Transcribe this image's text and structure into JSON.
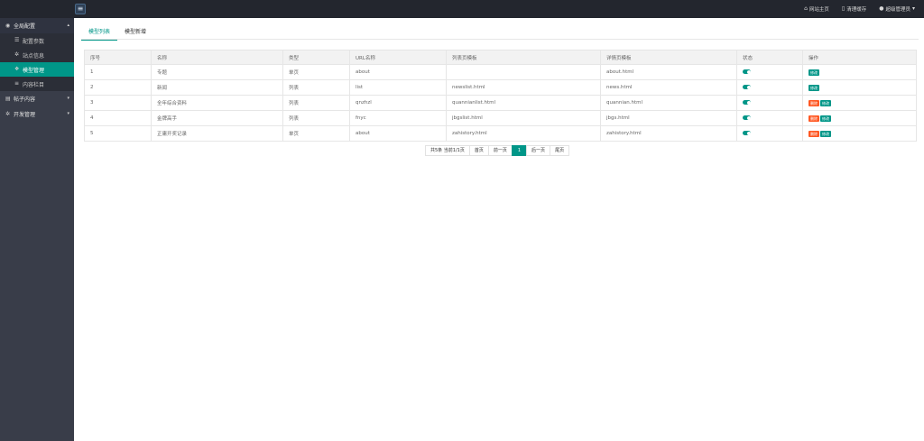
{
  "topbar": {
    "menu_icon": "hamburger-icon",
    "links": [
      {
        "icon": "home-icon",
        "label": "网站主页"
      },
      {
        "icon": "trash-icon",
        "label": "清理缓存"
      },
      {
        "icon": "user-icon",
        "label": "超级管理员"
      }
    ]
  },
  "sidebar": {
    "groups": [
      {
        "label": "全局配置",
        "icon": "globe-icon",
        "expanded": true,
        "items": [
          {
            "label": "配置参数",
            "icon": "sliders-icon"
          },
          {
            "label": "站点信息",
            "icon": "gear-icon"
          },
          {
            "label": "模型管理",
            "icon": "grid-icon",
            "active": true
          },
          {
            "label": "内容栏目",
            "icon": "list-icon"
          }
        ]
      },
      {
        "label": "帖子内容",
        "icon": "file-icon"
      },
      {
        "label": "开发管理",
        "icon": "gear-icon"
      }
    ]
  },
  "tabs": [
    {
      "label": "模型列表",
      "active": true
    },
    {
      "label": "模型新增"
    }
  ],
  "table": {
    "headers": [
      "序号",
      "名称",
      "类型",
      "URL名称",
      "列表页模板",
      "详情页模板",
      "状态",
      "操作"
    ],
    "rows": [
      {
        "id": "1",
        "name": "专题",
        "type": "单页",
        "url": "about",
        "list_tpl": "",
        "detail_tpl": "about.html",
        "status": true,
        "actions": [
          "修改"
        ]
      },
      {
        "id": "2",
        "name": "新闻",
        "type": "列表",
        "url": "list",
        "list_tpl": "newslist.html",
        "detail_tpl": "news.html",
        "status": true,
        "actions": [
          "修改"
        ]
      },
      {
        "id": "3",
        "name": "全年综合资料",
        "type": "列表",
        "url": "qnzhzl",
        "list_tpl": "quannianlist.html",
        "detail_tpl": "quannian.html",
        "status": true,
        "actions": [
          "删除",
          "修改"
        ]
      },
      {
        "id": "4",
        "name": "金牌高手",
        "type": "列表",
        "url": "fnyc",
        "list_tpl": "jbgslist.html",
        "detail_tpl": "jbgs.html",
        "status": true,
        "actions": [
          "删除",
          "修改"
        ]
      },
      {
        "id": "5",
        "name": "正庸开奖记录",
        "type": "单页",
        "url": "about",
        "list_tpl": "zahistory.html",
        "detail_tpl": "zahistory.html",
        "status": true,
        "actions": [
          "删除",
          "修改"
        ]
      }
    ]
  },
  "pager": {
    "summary": "共5条 当前1/1页",
    "first": "首页",
    "prev": "前一页",
    "current": "1",
    "next": "后一页",
    "last": "尾页"
  },
  "colors": {
    "accent": "#009688",
    "danger": "#ff5722",
    "topbar": "#23262e",
    "sidebar": "#393d49"
  }
}
